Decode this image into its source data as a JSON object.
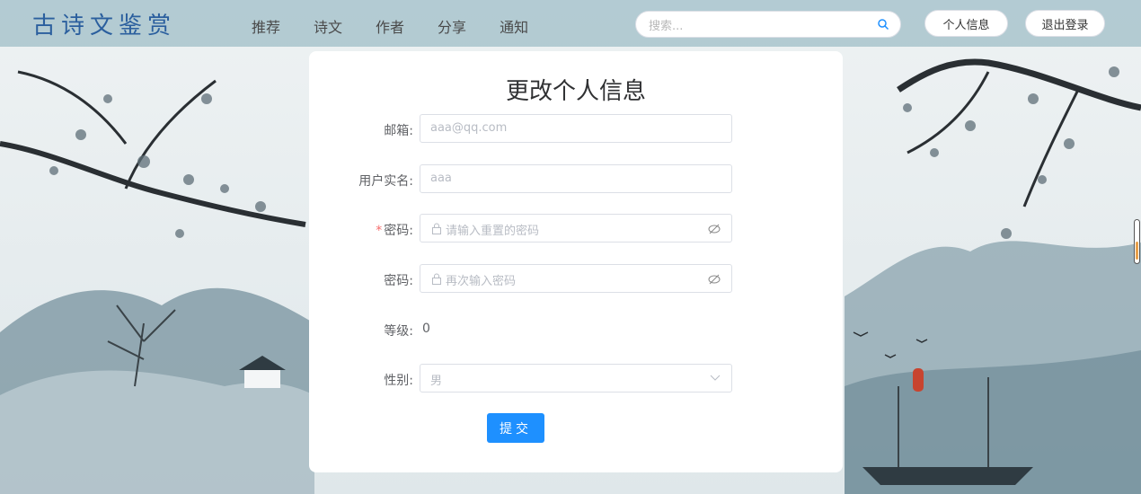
{
  "header": {
    "logo": "古诗文鉴赏",
    "nav": [
      "推荐",
      "诗文",
      "作者",
      "分享",
      "通知"
    ],
    "search_placeholder": "搜索...",
    "profile_button": "个人信息",
    "logout_button": "退出登录"
  },
  "form": {
    "title": "更改个人信息",
    "email_label": "邮箱:",
    "email_placeholder": "aaa@qq.com",
    "realname_label": "用户实名:",
    "realname_placeholder": "aaa",
    "password_required_mark": "*",
    "password_label": "密码:",
    "password_placeholder": "请输入重置的密码",
    "confirm_label": "密码:",
    "confirm_placeholder": "再次输入密码",
    "level_label": "等级:",
    "level_value": "0",
    "gender_label": "性别:",
    "gender_value": "男",
    "submit_label": "提交"
  },
  "colors": {
    "primary": "#1e90ff",
    "header_bg": "#a8c4cc",
    "logo": "#2b5f9e",
    "required": "#f56c6c"
  },
  "icons": [
    "search-icon",
    "lock-icon",
    "eye-off-icon",
    "chevron-down-icon"
  ]
}
